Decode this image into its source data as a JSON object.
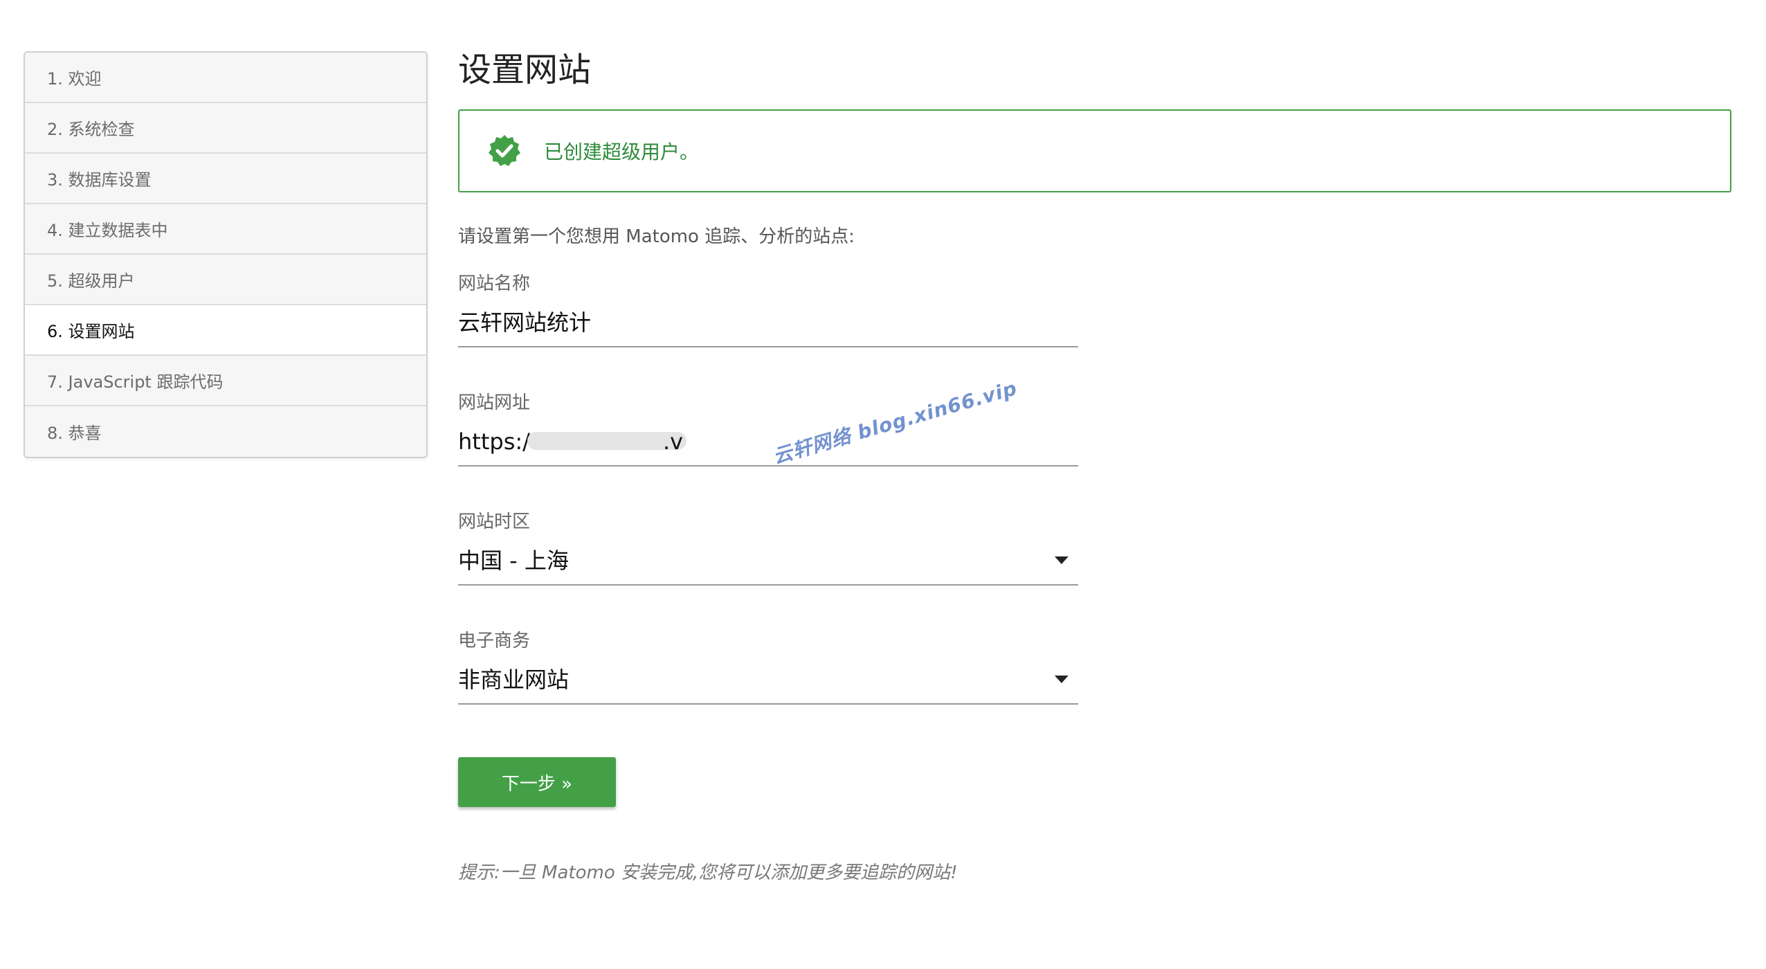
{
  "sidebar": {
    "steps": [
      {
        "label": "1. 欢迎"
      },
      {
        "label": "2. 系统检查"
      },
      {
        "label": "3. 数据库设置"
      },
      {
        "label": "4. 建立数据表中"
      },
      {
        "label": "5. 超级用户"
      },
      {
        "label": "6. 设置网站"
      },
      {
        "label": "7. JavaScript 跟踪代码"
      },
      {
        "label": "8. 恭喜"
      }
    ],
    "active_index": 5
  },
  "main": {
    "title": "设置网站",
    "alert": {
      "text": "已创建超级用户。",
      "icon": "verified-check-icon",
      "color": "#43a047"
    },
    "intro": "请设置第一个您想用 Matomo 追踪、分析的站点:",
    "fields": {
      "site_name": {
        "label": "网站名称",
        "value": "云轩网站统计"
      },
      "site_url": {
        "label": "网站网址",
        "value": "https:/",
        "suffix": ".v"
      },
      "timezone": {
        "label": "网站时区",
        "value": "中国 - 上海"
      },
      "ecommerce": {
        "label": "电子商务",
        "value": "非商业网站"
      }
    },
    "next_button": "下一步 »",
    "hint": "提示:一旦 Matomo 安装完成,您将可以添加更多要追踪的网站!"
  },
  "watermark": "云轩网络  blog.xin66.vip",
  "colors": {
    "accent": "#43a047",
    "sidebar_bg": "#f6f6f6"
  }
}
